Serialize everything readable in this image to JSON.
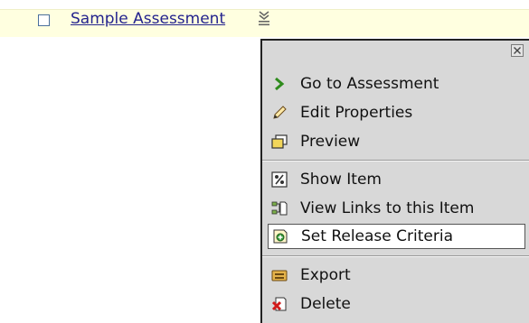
{
  "item": {
    "title": "Sample Assessment"
  },
  "menu": {
    "close_label": "×",
    "items": [
      {
        "label": "Go to Assessment",
        "icon": "chevron-right-icon"
      },
      {
        "label": "Edit Properties",
        "icon": "pencil-icon"
      },
      {
        "label": "Preview",
        "icon": "preview-window-icon"
      },
      {
        "label": "Show Item",
        "icon": "percent-icon"
      },
      {
        "label": "View Links to this Item",
        "icon": "links-icon"
      },
      {
        "label": "Set Release Criteria",
        "icon": "release-criteria-icon"
      },
      {
        "label": "Export",
        "icon": "export-icon"
      },
      {
        "label": "Delete",
        "icon": "delete-icon"
      }
    ]
  },
  "colors": {
    "row_background": "#ffffe0",
    "link": "#24238e",
    "menu_background": "#d8d8d8",
    "highlight_background": "#ffffff"
  }
}
